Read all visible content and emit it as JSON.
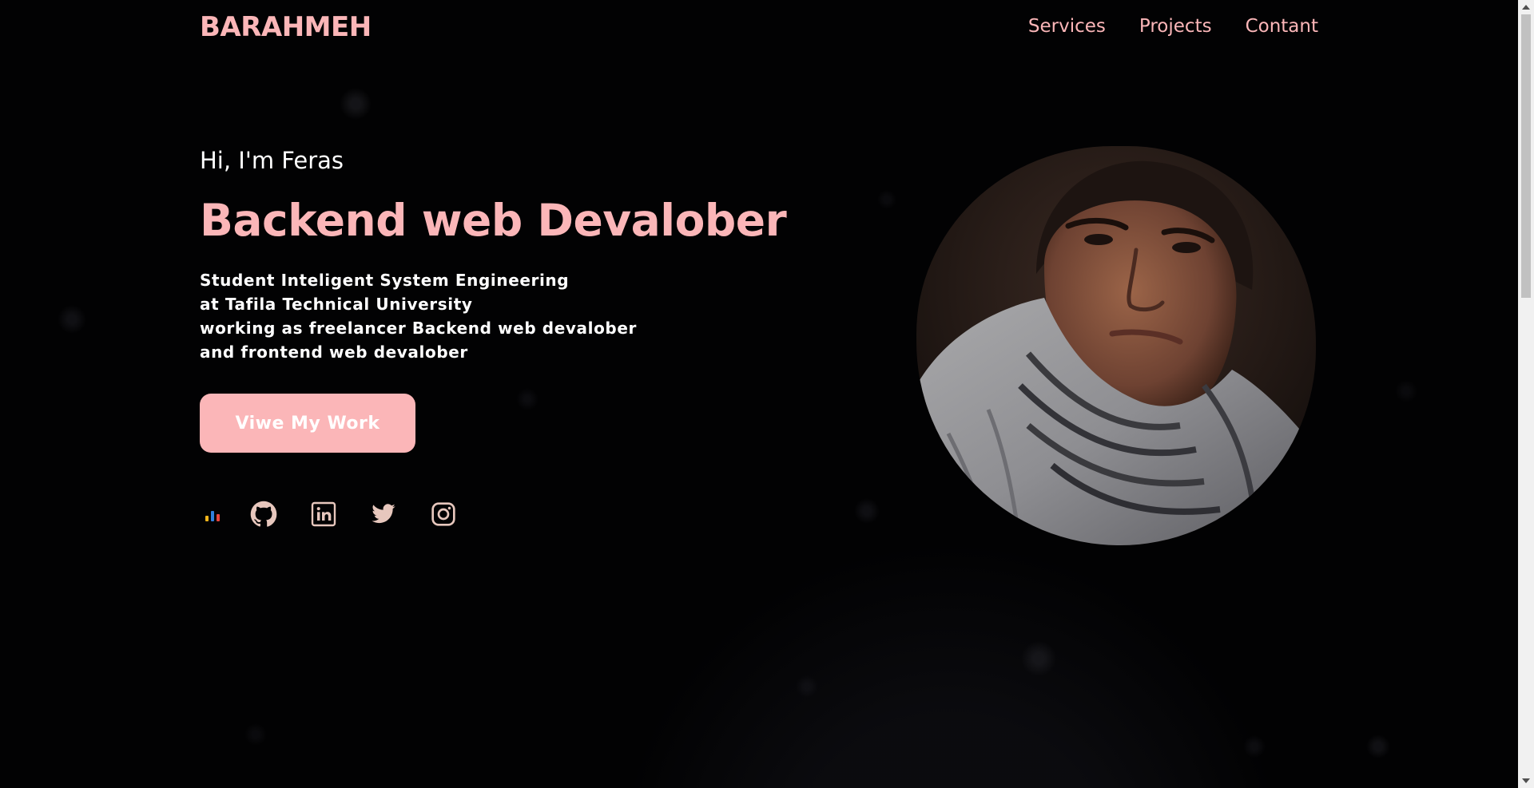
{
  "header": {
    "logo": "BARAHMEH",
    "nav": [
      {
        "label": "Services"
      },
      {
        "label": "Projects"
      },
      {
        "label": "Contant"
      }
    ]
  },
  "hero": {
    "greeting": "Hi, I'm Feras",
    "role": "Backend web Devalober",
    "bio": [
      "Student Inteligent System Engineering",
      "at Tafila Technical University",
      "working as freelancer Backend web devalober",
      "and frontend web devalober"
    ],
    "cta_label": "Viwe My Work"
  },
  "socials": [
    {
      "name": "analytics-icon"
    },
    {
      "name": "github-icon"
    },
    {
      "name": "linkedin-icon"
    },
    {
      "name": "twitter-icon"
    },
    {
      "name": "instagram-icon"
    }
  ],
  "colors": {
    "background": "#020203",
    "accent": "#fbb6b8",
    "text": "#ffffff",
    "icon": "#e7c7bd"
  }
}
